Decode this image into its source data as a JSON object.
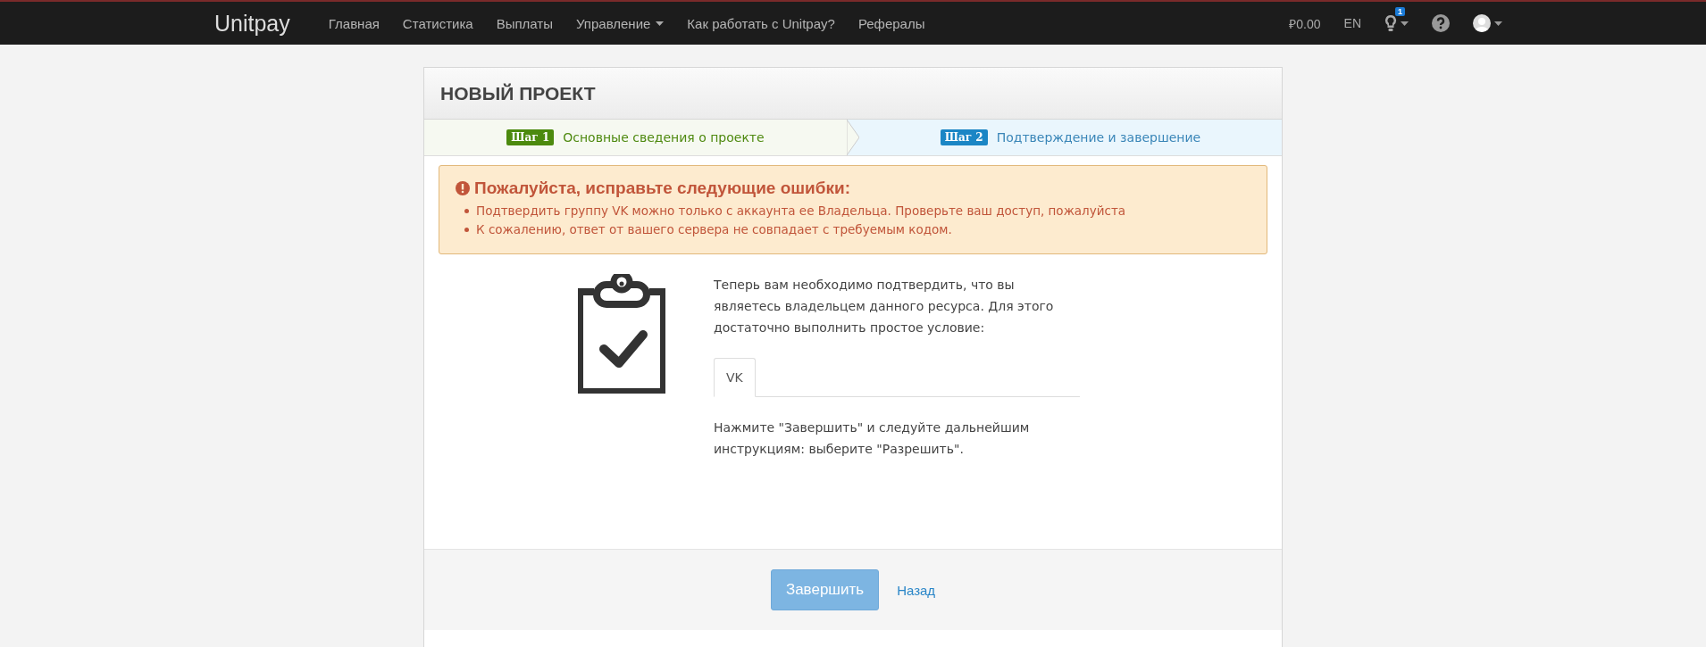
{
  "navbar": {
    "logo": "Unitpay",
    "items": [
      {
        "label": "Главная",
        "dropdown": false
      },
      {
        "label": "Статистика",
        "dropdown": false
      },
      {
        "label": "Выплаты",
        "dropdown": false
      },
      {
        "label": "Управление",
        "dropdown": true
      },
      {
        "label": "Как работать с Unitpay?",
        "dropdown": false
      },
      {
        "label": "Рефералы",
        "dropdown": false
      }
    ],
    "balance": "₽0.00",
    "language": "EN",
    "notifications_badge": "1"
  },
  "panel": {
    "title": "НОВЫЙ ПРОЕКТ",
    "steps": [
      {
        "badge": "Шаг 1",
        "label": "Основные сведения о проекте",
        "selected": false
      },
      {
        "badge": "Шаг 2",
        "label": "Подтверждение и завершение",
        "selected": true
      }
    ],
    "error": {
      "title": "Пожалуйста, исправьте следующие ошибки:",
      "items": [
        "Подтвердить группу VK можно только с аккаунта ее Владельца. Проверьте ваш доступ, пожалуйста",
        "К сожалению, ответ от вашего сервера не совпадает с требуемым кодом."
      ]
    },
    "intro": "Теперь вам необходимо подтвердить, что вы являетесь владельцем данного ресурса. Для этого достаточно выполнить простое условие:",
    "tabs": [
      {
        "label": "VK",
        "selected": true
      }
    ],
    "instruction": "Нажмите \"Завершить\" и следуйте дальнейшим инструкциям: выберите \"Разрешить\".",
    "submit": {
      "label": "Завершить",
      "disabled": true
    },
    "back_link": "Назад"
  }
}
